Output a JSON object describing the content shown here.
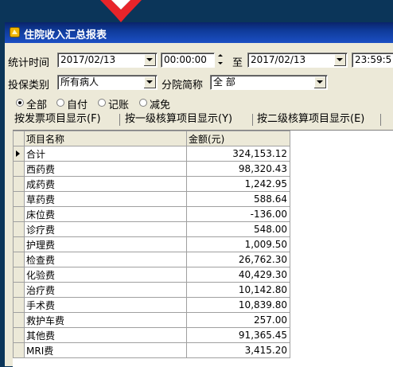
{
  "window": {
    "title": "住院收入汇总报表"
  },
  "filters": {
    "stat_time_label": "统计时间",
    "start_date": "2017/02/13",
    "start_time": "00:00:00",
    "to_label": "至",
    "end_date": "2017/02/13",
    "end_time": "23:59:5",
    "insurance_label": "投保类别",
    "insurance_value": "所有病人",
    "branch_label": "分院简称",
    "branch_value": "全 部"
  },
  "radios": [
    {
      "label": "全部",
      "checked": true
    },
    {
      "label": "自付",
      "checked": false
    },
    {
      "label": "记账",
      "checked": false
    },
    {
      "label": "减免",
      "checked": false
    }
  ],
  "tabs": [
    {
      "label": "按发票项目显示(F)"
    },
    {
      "label": "按一级核算项目显示(Y)"
    },
    {
      "label": "按二级核算项目显示(E)"
    }
  ],
  "grid": {
    "columns": [
      "项目名称",
      "金额(元)"
    ],
    "rows": [
      {
        "name": " 合计",
        "amount": "324,153.12"
      },
      {
        "name": "西药费",
        "amount": "98,320.43"
      },
      {
        "name": "成药费",
        "amount": "1,242.95"
      },
      {
        "name": "草药费",
        "amount": "588.64"
      },
      {
        "name": "床位费",
        "amount": "-136.00"
      },
      {
        "name": "诊疗费",
        "amount": "548.00"
      },
      {
        "name": "护理费",
        "amount": "1,009.50"
      },
      {
        "name": "检查费",
        "amount": "26,762.30"
      },
      {
        "name": "化验费",
        "amount": "40,429.30"
      },
      {
        "name": "治疗费",
        "amount": "10,142.80"
      },
      {
        "name": "手术费",
        "amount": "10,839.80"
      },
      {
        "name": "救护车费",
        "amount": "257.00"
      },
      {
        "name": "其他费",
        "amount": "91,365.45"
      },
      {
        "name": "MRI费",
        "amount": "3,415.20"
      }
    ]
  },
  "colors": {
    "titlebar": "#0f3b9a",
    "desktop": "#0b3559",
    "logo": "#e8242a"
  }
}
